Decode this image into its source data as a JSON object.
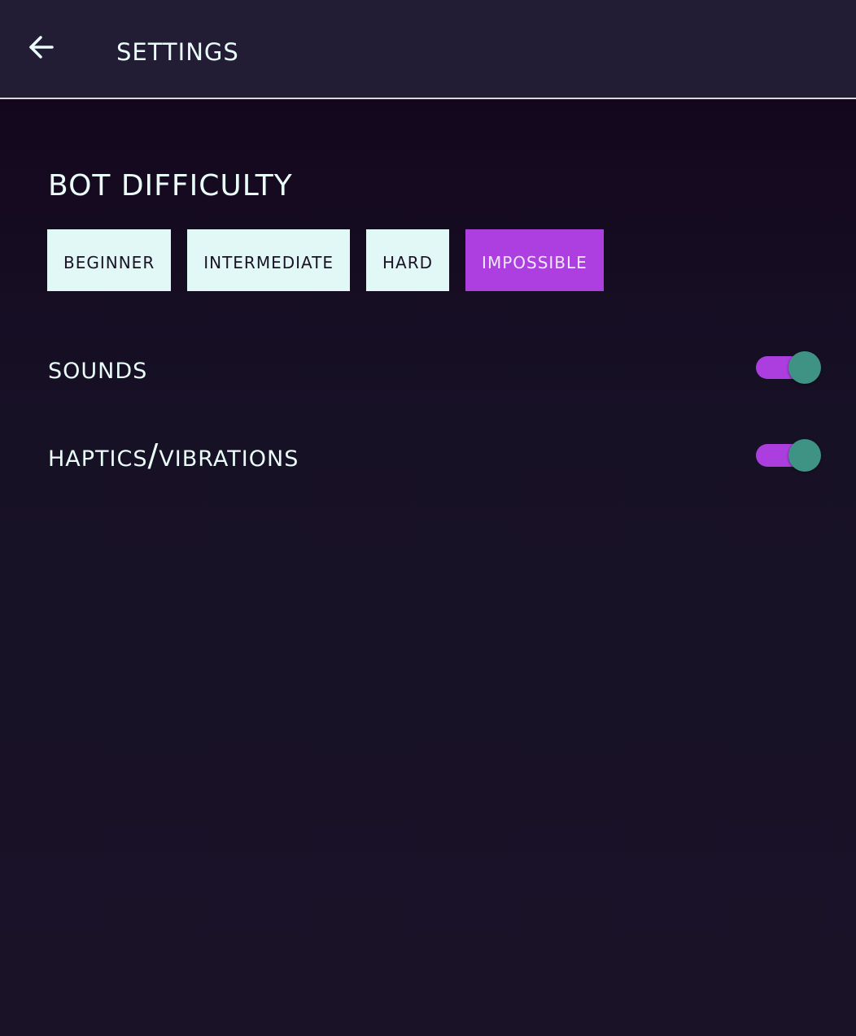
{
  "header": {
    "back_icon": "arrow-left-icon",
    "title": "settings"
  },
  "bot_difficulty": {
    "title": "BOT DIFFICULTY",
    "options": [
      {
        "label": "beginner",
        "selected": false
      },
      {
        "label": "intermediate",
        "selected": false
      },
      {
        "label": "hard",
        "selected": false
      },
      {
        "label": "impossible",
        "selected": true
      }
    ]
  },
  "settings": [
    {
      "label": "sounds",
      "enabled": true
    },
    {
      "label": "haptics/vibrations",
      "enabled": true
    }
  ],
  "colors": {
    "accent": "#ad3ee0",
    "toggle_thumb": "#3f9384",
    "header_bg": "#221c35",
    "body_bg": "#171126",
    "button_bg": "#e2f8f6",
    "text": "#eafcfa"
  }
}
